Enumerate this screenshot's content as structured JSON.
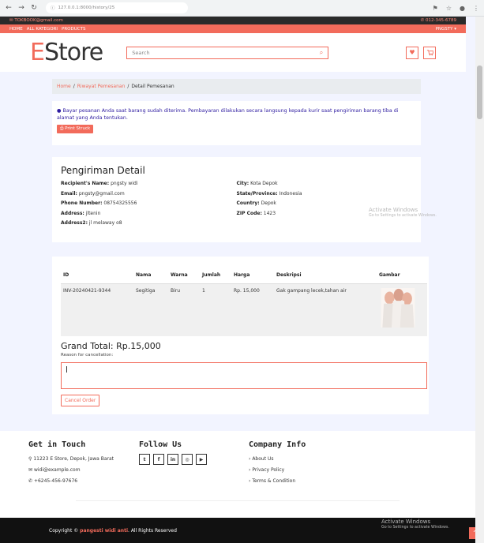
{
  "browser": {
    "url": "127.0.0.1:8000/history/25"
  },
  "topbar": {
    "email": "TOKBOOK@gmail.com",
    "phone": "012-345-6789"
  },
  "menubar": {
    "items": [
      "HOME",
      "ALL KATEGORI",
      "PRODUCTS"
    ],
    "user": "PNGSTY ▾"
  },
  "header": {
    "logo_first": "E",
    "logo_rest": "Store",
    "search_placeholder": "Search"
  },
  "breadcrumb": {
    "home": "Home",
    "sep1": "/",
    "history": "Riwayat Pemesanan",
    "sep2": "/",
    "current": "Detail Pemesanan"
  },
  "alert": {
    "text": "Bayar pesanan Anda saat barang sudah diterima. Pembayaran dilakukan secara langsung kepada kurir saat pengiriman barang tiba di alamat yang Anda tentukan.",
    "print_label": "Print Struck"
  },
  "shipping": {
    "title": "Pengiriman Detail",
    "left": [
      {
        "label": "Recipient's Name:",
        "value": "pngsty widi"
      },
      {
        "label": "Email:",
        "value": "pngsty@gmail.com"
      },
      {
        "label": "Phone Number:",
        "value": "08754325556"
      },
      {
        "label": "Address:",
        "value": "jltenin"
      },
      {
        "label": "Address2:",
        "value": "jl melaway o8"
      }
    ],
    "right": [
      {
        "label": "City:",
        "value": "Kota Depok"
      },
      {
        "label": "State/Province:",
        "value": "Indonesia"
      },
      {
        "label": "Country:",
        "value": "Depok"
      },
      {
        "label": "ZIP Code:",
        "value": "1423"
      }
    ]
  },
  "order": {
    "headers": [
      "ID",
      "Nama",
      "Warna",
      "Jumlah",
      "Harga",
      "Deskripsi",
      "Gambar"
    ],
    "rows": [
      {
        "id": "INV-20240421-9344",
        "nama": "Segitiga",
        "warna": "Biru",
        "jumlah": "1",
        "harga": "Rp. 15,000",
        "deskripsi": "Gak gampang lecek,tahan air"
      }
    ],
    "grand_total": "Grand Total: Rp.15,000",
    "reason_label": "Reason for cancellation:",
    "cancel_label": "Cancel Order"
  },
  "footer": {
    "get_in_touch": {
      "title": "Get in Touch",
      "address": "11223 E Store, Depok, Jawa Barat",
      "email": "widi@example.com",
      "phone": "+6245-456-97676"
    },
    "follow_us": {
      "title": "Follow Us",
      "icons": [
        "twitter-icon",
        "facebook-icon",
        "linkedin-icon",
        "instagram-icon",
        "youtube-icon"
      ]
    },
    "company": {
      "title": "Company Info",
      "links": [
        "About Us",
        "Privacy Policy",
        "Terms & Condition"
      ]
    }
  },
  "bottombar": {
    "prefix": "Copyright ©",
    "brand": "pangesti widi anti",
    "suffix": ". All Rights Reserved"
  },
  "watermark": {
    "title": "Activate Windows",
    "subtitle": "Go to Settings to activate Windows."
  },
  "colors": {
    "accent": "#f26b5b",
    "dark": "#2a2a2a",
    "alert_text": "#2d1ba0"
  }
}
